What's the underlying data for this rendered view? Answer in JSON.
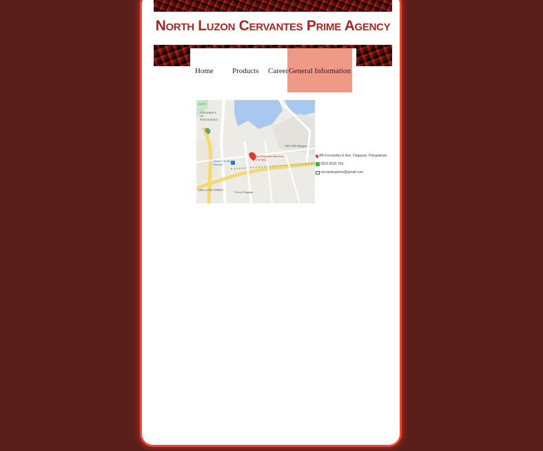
{
  "site": {
    "title": "North Luzon Cervantes Prime Agency"
  },
  "nav": {
    "items": [
      {
        "label": "Home"
      },
      {
        "label": "Products"
      },
      {
        "label": "Career"
      },
      {
        "label": "General Information"
      }
    ],
    "active_index": 3
  },
  "map": {
    "labels": {
      "university": "UNIVERSITY OF PANGASINAN",
      "bus_terminal": "Alonzo City Bus Terminal",
      "business": "The Philippine American Life And...",
      "street": "ARELLANO STREET",
      "victory": "Victory Dagupan",
      "abs": "ABS-CBN Dagupan",
      "corner": "hmk33"
    },
    "icons": [
      "location-pin-icon",
      "bus-icon",
      "map-marker-icon"
    ]
  },
  "contact": {
    "address": "AB Fernandez E Ave, Dagupan, Pangasinan",
    "phone": "0922 8160 766",
    "email": "cervantesprime@gmail.com"
  },
  "colors": {
    "background": "#5a1f1b",
    "title": "#a22b21",
    "nav_active": "#ef9a87",
    "page": "#ffffff",
    "frame_glow": "#e0503a"
  }
}
